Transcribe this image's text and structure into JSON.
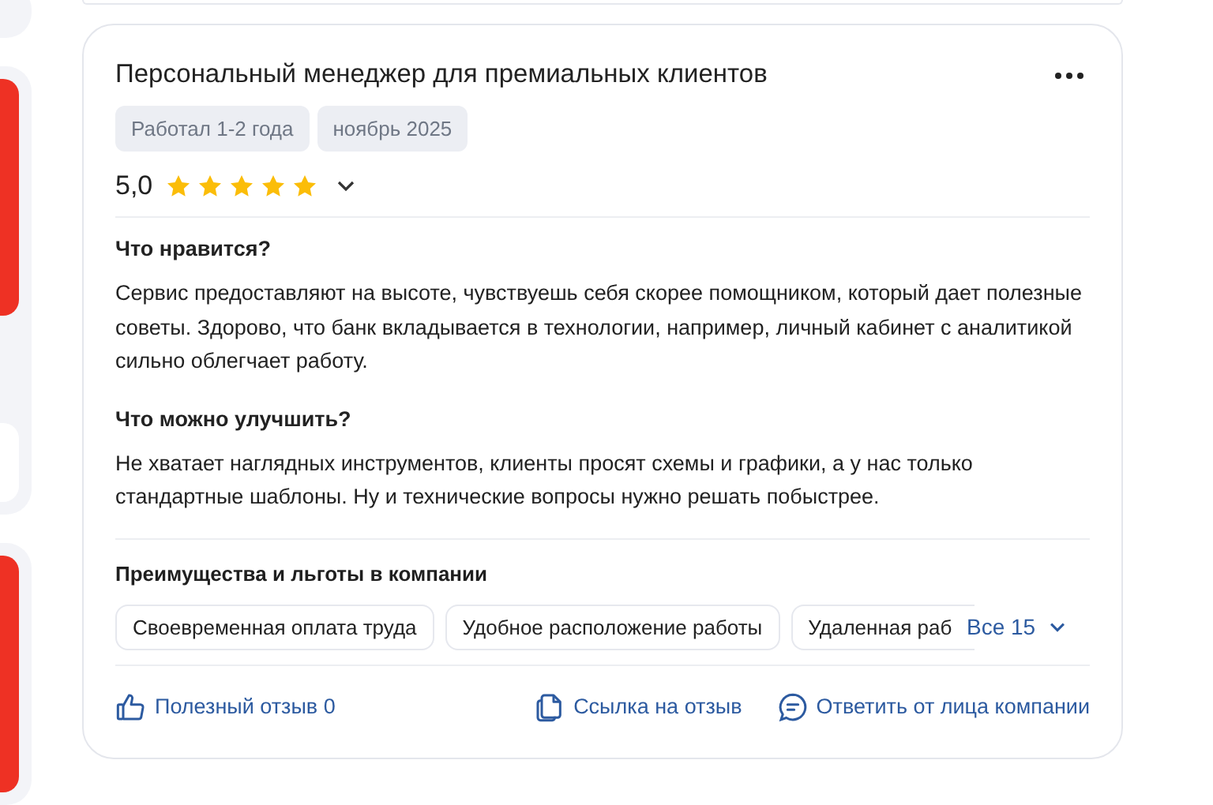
{
  "review": {
    "title": "Персональный менеджер для премиальных клиентов",
    "tags": [
      "Работал 1-2 года",
      "ноябрь 2025"
    ],
    "rating": "5,0",
    "stars": 5,
    "sections": [
      {
        "heading": "Что нравится?",
        "text": "Сервис предоставляют на высоте, чувствуешь себя скорее помощником, который дает полезные советы. Здорово, что банк вкладывается в технологии, например, личный кабинет с аналитикой сильно облегчает работу."
      },
      {
        "heading": "Что можно улучшить?",
        "text": "Не хватает наглядных инструментов, клиенты просят схемы и графики, а у нас только стандартные шаблоны. Ну и технические вопросы нужно решать побыстрее."
      }
    ],
    "benefits_heading": "Преимущества и льготы в компании",
    "benefits": [
      "Своевременная оплата труда",
      "Удобное расположение работы",
      "Удаленная раб"
    ],
    "benefits_more": "Все 15",
    "actions": [
      {
        "kind": "like",
        "label": "Полезный отзыв 0"
      },
      {
        "kind": "link",
        "label": "Ссылка на отзыв"
      },
      {
        "kind": "reply",
        "label": "Ответить от лица компании"
      }
    ]
  }
}
